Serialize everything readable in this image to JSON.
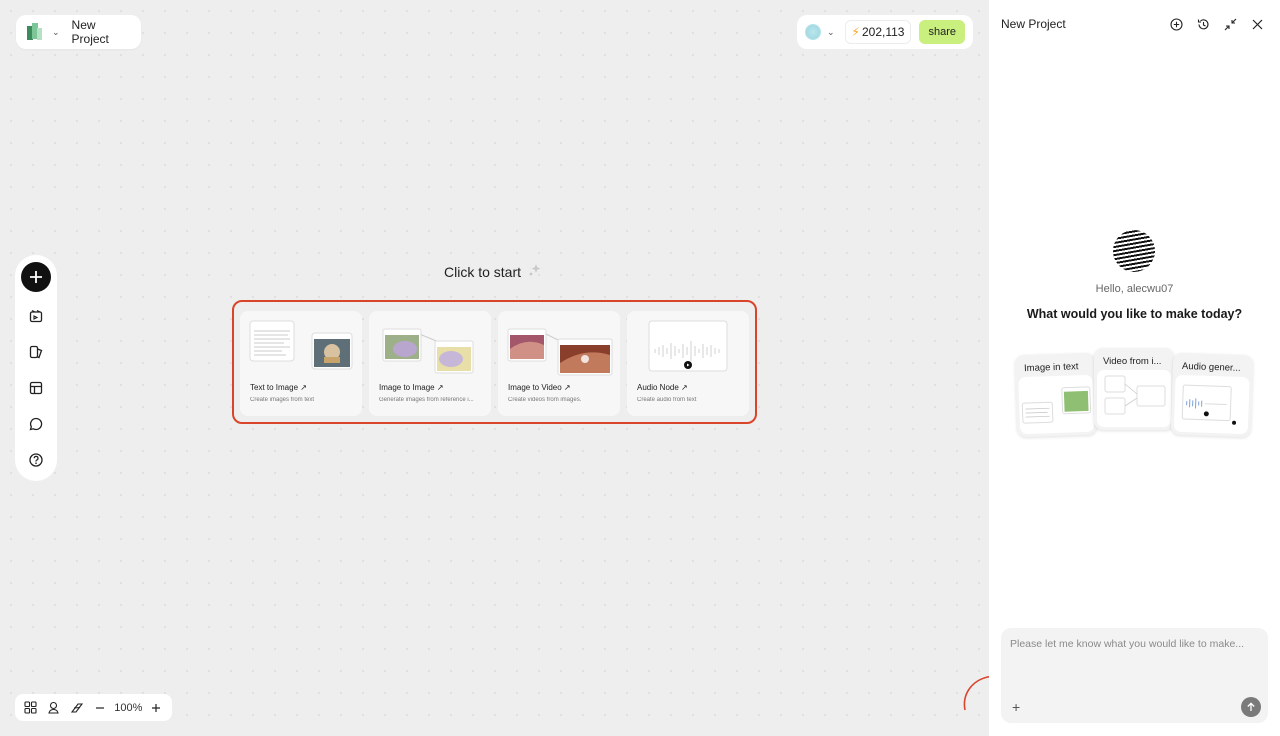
{
  "header": {
    "project_title": "New Project",
    "credits": "202,113",
    "share_label": "share"
  },
  "canvas": {
    "click_to_start": "Click to start",
    "zoom_level": "100%"
  },
  "templates": [
    {
      "title": "Text to Image",
      "subtitle": "Create images from text"
    },
    {
      "title": "Image to Image",
      "subtitle": "Generate images from reference i..."
    },
    {
      "title": "Image to Video",
      "subtitle": "Create videos from images."
    },
    {
      "title": "Audio Node",
      "subtitle": "Create audio from text"
    }
  ],
  "panel": {
    "title": "New Project",
    "greeting": "Hello, alecwu07",
    "question": "What would you like to make today?",
    "suggestions": [
      {
        "label": "Image in text"
      },
      {
        "label": "Video from i..."
      },
      {
        "label": "Audio gener..."
      }
    ],
    "input_placeholder": "Please let me know what you would like to make..."
  },
  "colors": {
    "share_bg": "#c9ef7e",
    "highlight_border": "#d9452a"
  }
}
